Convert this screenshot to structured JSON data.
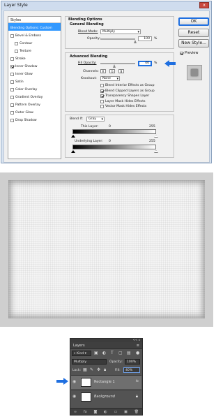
{
  "dialog": {
    "title": "Layer Style",
    "close_glyph": "x",
    "styles_header": "Styles",
    "styles": [
      {
        "label": "Blending Options: Custom",
        "checkbox": false,
        "selected": true,
        "indent": false
      },
      {
        "label": "Bevel & Emboss",
        "checkbox": true,
        "checked": false,
        "indent": false
      },
      {
        "label": "Contour",
        "checkbox": true,
        "checked": false,
        "indent": true
      },
      {
        "label": "Texture",
        "checkbox": true,
        "checked": false,
        "indent": true
      },
      {
        "label": "Stroke",
        "checkbox": true,
        "checked": false,
        "indent": false
      },
      {
        "label": "Inner Shadow",
        "checkbox": true,
        "checked": true,
        "indent": false
      },
      {
        "label": "Inner Glow",
        "checkbox": true,
        "checked": false,
        "indent": false
      },
      {
        "label": "Satin",
        "checkbox": true,
        "checked": false,
        "indent": false
      },
      {
        "label": "Color Overlay",
        "checkbox": true,
        "checked": false,
        "indent": false
      },
      {
        "label": "Gradient Overlay",
        "checkbox": true,
        "checked": false,
        "indent": false
      },
      {
        "label": "Pattern Overlay",
        "checkbox": true,
        "checked": false,
        "indent": false
      },
      {
        "label": "Outer Glow",
        "checkbox": true,
        "checked": false,
        "indent": false
      },
      {
        "label": "Drop Shadow",
        "checkbox": true,
        "checked": false,
        "indent": false
      }
    ],
    "blending_options": {
      "title": "Blending Options",
      "general_title": "General Blending",
      "blend_mode_label": "Blend Mode:",
      "blend_mode_value": "Multiply",
      "opacity_label": "Opacity:",
      "opacity_value": "100",
      "opacity_unit": "%",
      "opacity_level": 1.0
    },
    "advanced": {
      "title": "Advanced Blending",
      "fill_opacity_label": "Fill Opacity:",
      "fill_opacity_value": "40",
      "fill_opacity_unit": "%",
      "fill_opacity_level": 0.4,
      "channels_label": "Channels:",
      "channels": [
        "R",
        "G",
        "B"
      ],
      "knockout_label": "Knockout:",
      "knockout_value": "None",
      "options": [
        {
          "label": "Blend Interior Effects as Group",
          "checked": false
        },
        {
          "label": "Blend Clipped Layers as Group",
          "checked": true
        },
        {
          "label": "Transparency Shapes Layer",
          "checked": true
        },
        {
          "label": "Layer Mask Hides Effects",
          "checked": false
        },
        {
          "label": "Vector Mask Hides Effects",
          "checked": false
        }
      ]
    },
    "blend_if": {
      "label": "Blend If:",
      "value": "Gray",
      "this_layer_label": "This Layer:",
      "this_layer_low": "0",
      "this_layer_high": "255",
      "underlying_label": "Underlying Layer:",
      "underlying_low": "0",
      "underlying_high": "255"
    },
    "buttons": {
      "ok": "OK",
      "reset": "Reset",
      "new_style": "New Style...",
      "preview_label": "Preview",
      "preview_checked": true
    }
  },
  "layers_panel": {
    "header_controls": "<< x",
    "tab_label": "Layers",
    "menu_glyph": "≡",
    "kind_label": "Kind",
    "filter_icons": [
      "image-filter-icon",
      "adjustment-filter-icon",
      "type-filter-icon",
      "shape-filter-icon",
      "smart-object-filter-icon"
    ],
    "blend_mode": "Multiply",
    "opacity_label": "Opacity:",
    "opacity_value": "100%",
    "lock_label": "Lock:",
    "fill_label": "Fill:",
    "fill_value": "40%",
    "layers": [
      {
        "name": "Rectangle 1",
        "badge": "fx",
        "active": true,
        "italic": false
      },
      {
        "name": "Background",
        "badge": "lock",
        "active": false,
        "italic": true
      }
    ]
  },
  "colors": {
    "accent": "#1f6fe0",
    "selection": "#3399ff",
    "panel_dark": "#535353"
  }
}
